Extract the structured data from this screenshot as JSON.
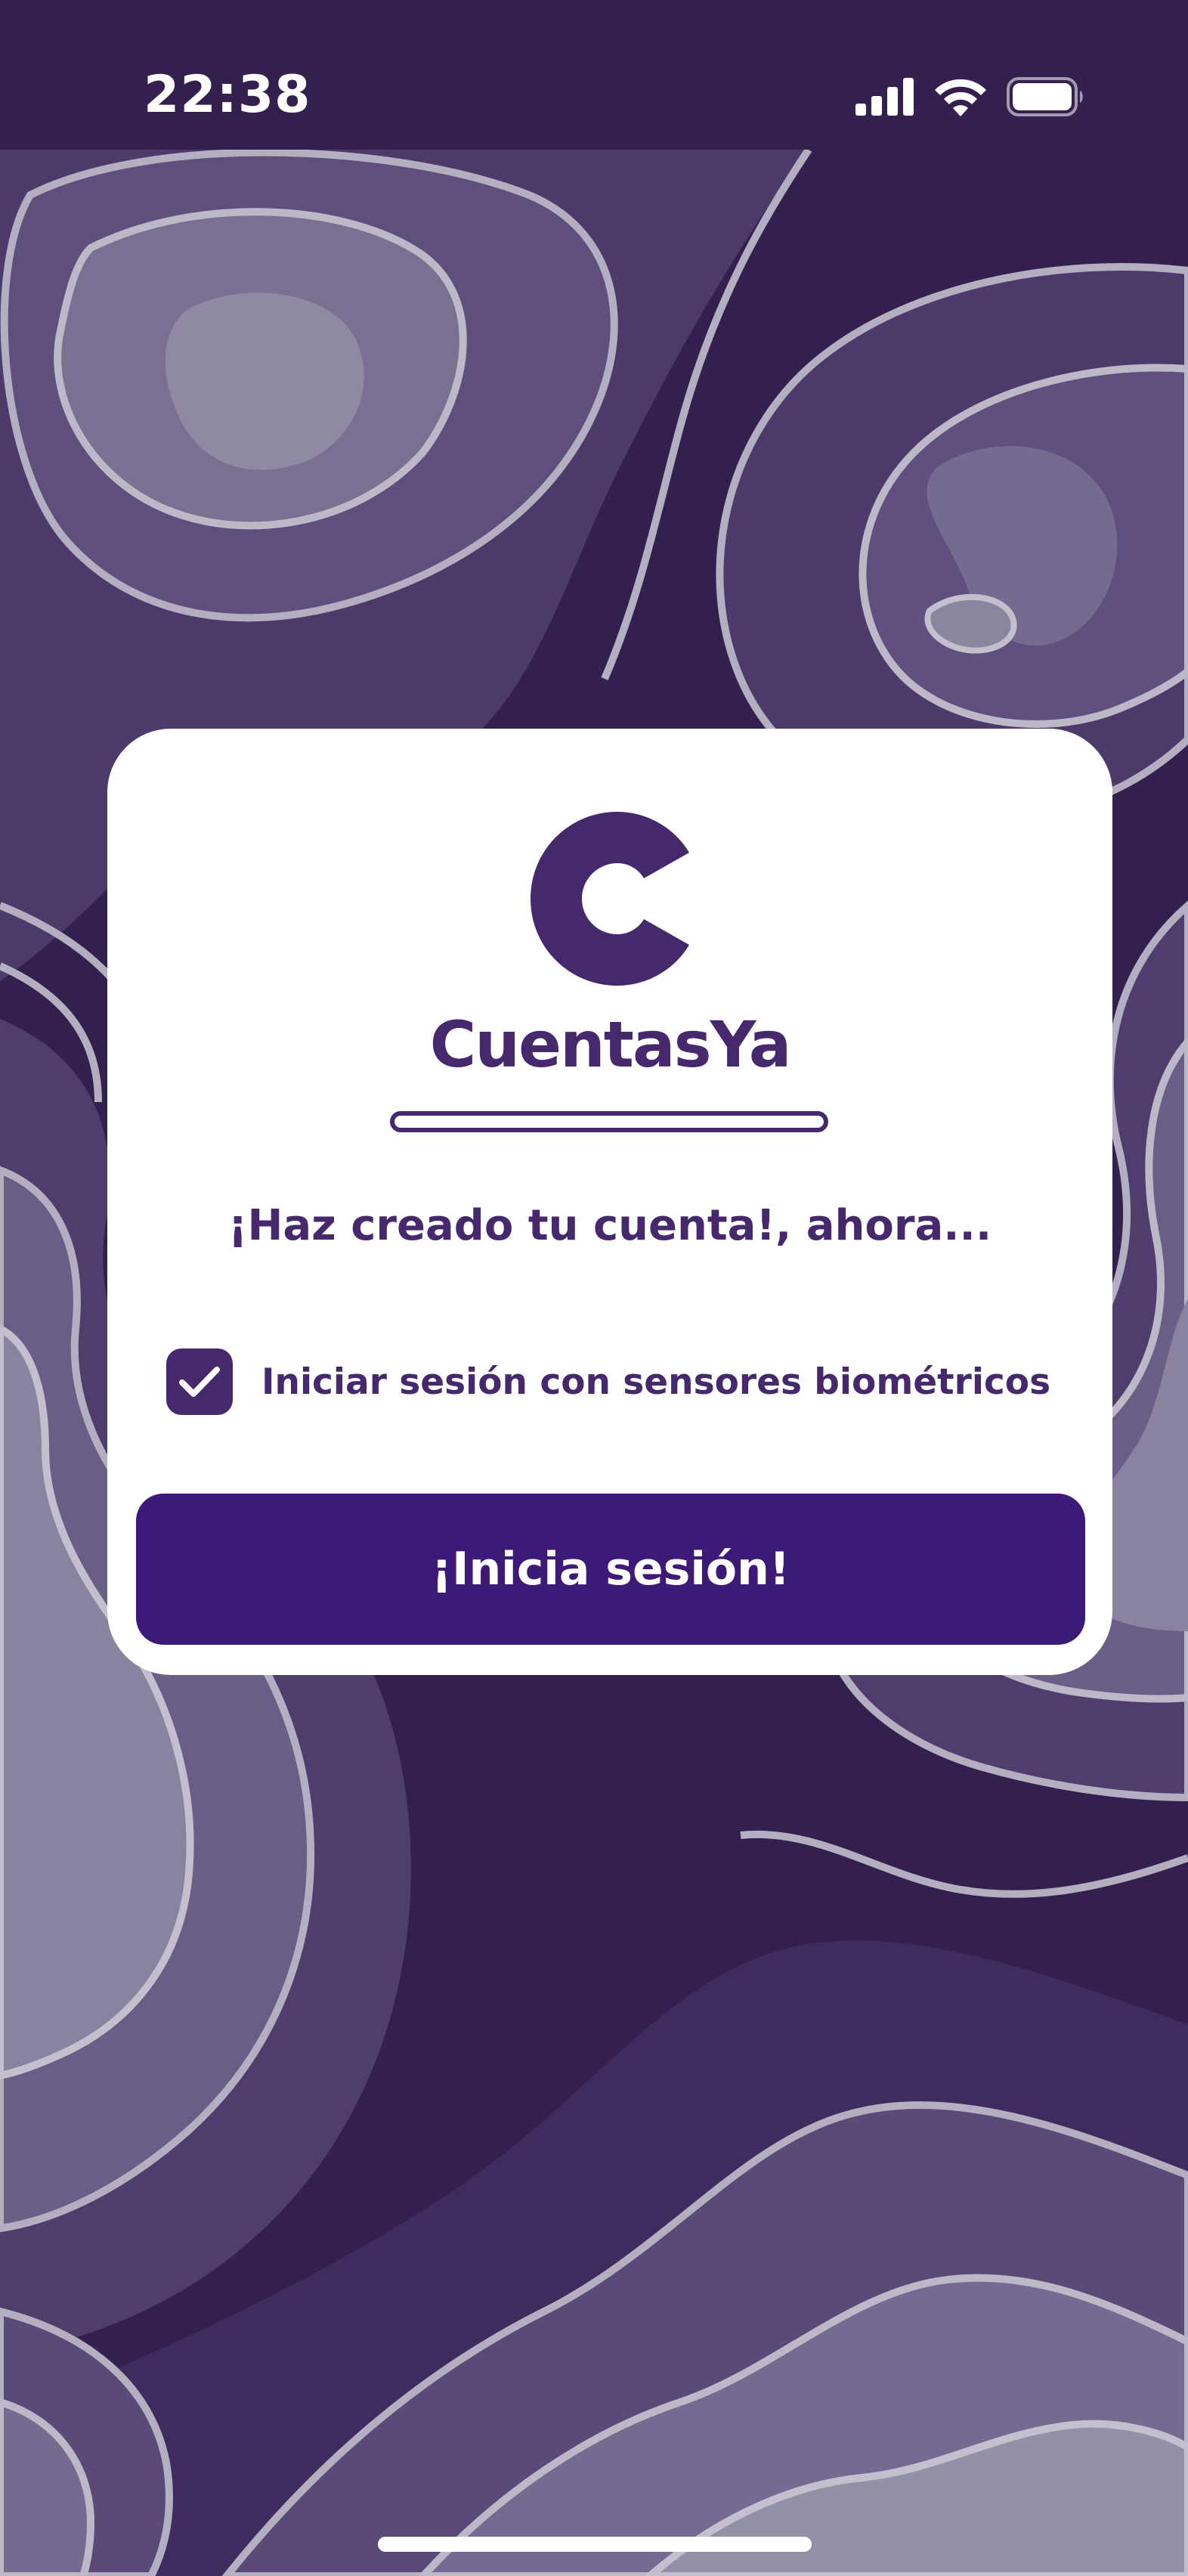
{
  "status_bar": {
    "time": "22:38",
    "icons": [
      "cellular-signal-icon",
      "wifi-icon",
      "battery-icon"
    ]
  },
  "brand": {
    "logo_icon": "cuentasya-c-logo",
    "name": "CuentasYa"
  },
  "card": {
    "headline": "¡Haz creado tu cuenta!, ahora...",
    "biometric": {
      "label": "Iniciar sesión con sensores biométricos",
      "checked": true
    },
    "login_button_label": "¡Inicia sesión!"
  },
  "colors": {
    "background": "#33204f",
    "brand_purple": "#46296d",
    "button_purple": "#3e1a78",
    "card": "#ffffff"
  }
}
